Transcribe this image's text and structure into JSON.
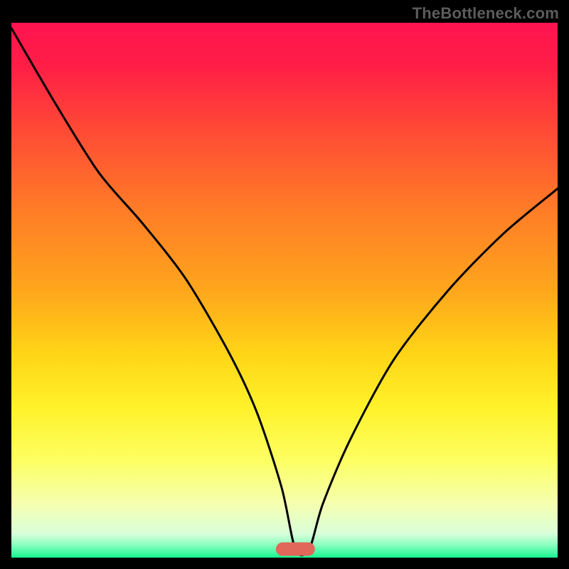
{
  "attribution": "TheBottleneck.com",
  "colors": {
    "background": "#000000",
    "gradient_stops": [
      {
        "offset": 0.0,
        "color": "#ff1450"
      },
      {
        "offset": 0.08,
        "color": "#ff1e46"
      },
      {
        "offset": 0.2,
        "color": "#ff4a35"
      },
      {
        "offset": 0.35,
        "color": "#ff7c27"
      },
      {
        "offset": 0.5,
        "color": "#ffa61c"
      },
      {
        "offset": 0.62,
        "color": "#ffd516"
      },
      {
        "offset": 0.72,
        "color": "#fff22a"
      },
      {
        "offset": 0.82,
        "color": "#fdff63"
      },
      {
        "offset": 0.9,
        "color": "#f5ffb0"
      },
      {
        "offset": 0.955,
        "color": "#d9ffda"
      },
      {
        "offset": 0.975,
        "color": "#8fffc0"
      },
      {
        "offset": 1.0,
        "color": "#18f590"
      }
    ],
    "curve": "#000000",
    "marker_fill": "#e0675a",
    "marker_stroke": "#e0675a"
  },
  "chart_data": {
    "type": "line",
    "title": "",
    "xlabel": "",
    "ylabel": "",
    "xlim": [
      0,
      100
    ],
    "ylim": [
      0,
      100
    ],
    "series": [
      {
        "name": "bottleneck-curve",
        "x": [
          0.0,
          8.0,
          16.0,
          24.0,
          32.0,
          40.0,
          45.0,
          49.5,
          52.0,
          54.5,
          57.0,
          62.0,
          70.0,
          80.0,
          90.0,
          100.0
        ],
        "values": [
          99.0,
          85.0,
          72.0,
          62.5,
          52.0,
          38.0,
          27.0,
          13.0,
          1.5,
          1.5,
          10.0,
          22.0,
          37.0,
          50.0,
          60.5,
          69.0
        ]
      }
    ],
    "marker": {
      "x_center": 52.0,
      "y_center": 1.6,
      "width": 7.0,
      "height": 2.4
    }
  }
}
